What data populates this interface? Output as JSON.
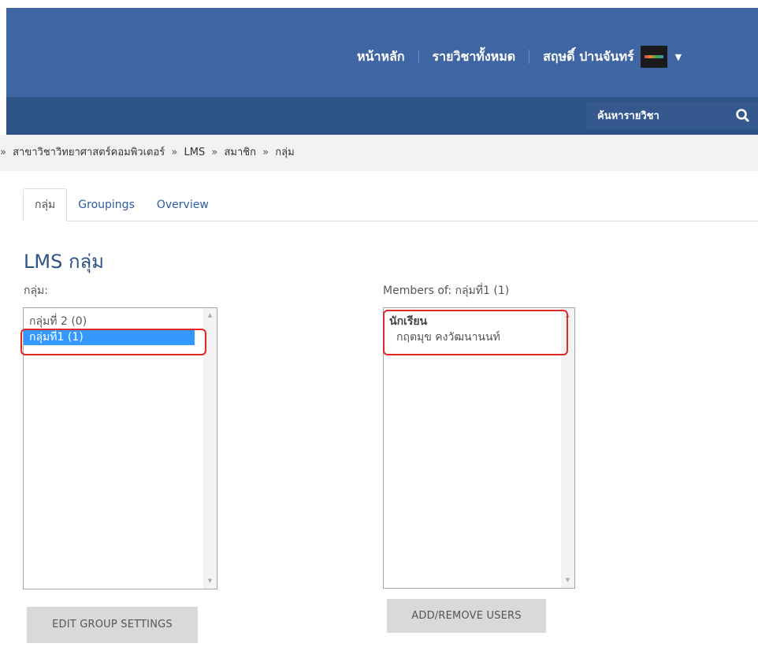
{
  "nav": {
    "home": "หน้าหลัก",
    "all_courses": "รายวิชาทั้งหมด",
    "user_name": "สฤษดิ์ ปานจันทร์"
  },
  "search": {
    "placeholder": "ค้นหารายวิชา"
  },
  "breadcrumb": {
    "lead": "»",
    "items": [
      "สาขาวิชาวิทยาศาสตร์คอมพิวเตอร์",
      "LMS",
      "สมาชิก",
      "กลุ่ม"
    ],
    "separator": "»"
  },
  "tabs": [
    {
      "label": "กลุ่ม",
      "active": true
    },
    {
      "label": "Groupings",
      "active": false
    },
    {
      "label": "Overview",
      "active": false
    }
  ],
  "page_title": "LMS กลุ่ม",
  "groups_panel": {
    "label": "กลุ่ม:",
    "options": [
      {
        "label": "กลุ่มที่ 2 (0)",
        "selected": false
      },
      {
        "label": "กลุ่มที่1 (1)",
        "selected": true
      }
    ],
    "button": "EDIT GROUP SETTINGS"
  },
  "members_panel": {
    "label": "Members of: กลุ่มที่1 (1)",
    "role": "นักเรียน",
    "members": [
      "กฤตมุข คงวัฒนานนท์"
    ],
    "button": "ADD/REMOVE USERS"
  },
  "colors": {
    "topbar": "#3f66a3",
    "subbar": "#2d5286",
    "selection": "#3399ff",
    "highlight": "#e02828"
  }
}
